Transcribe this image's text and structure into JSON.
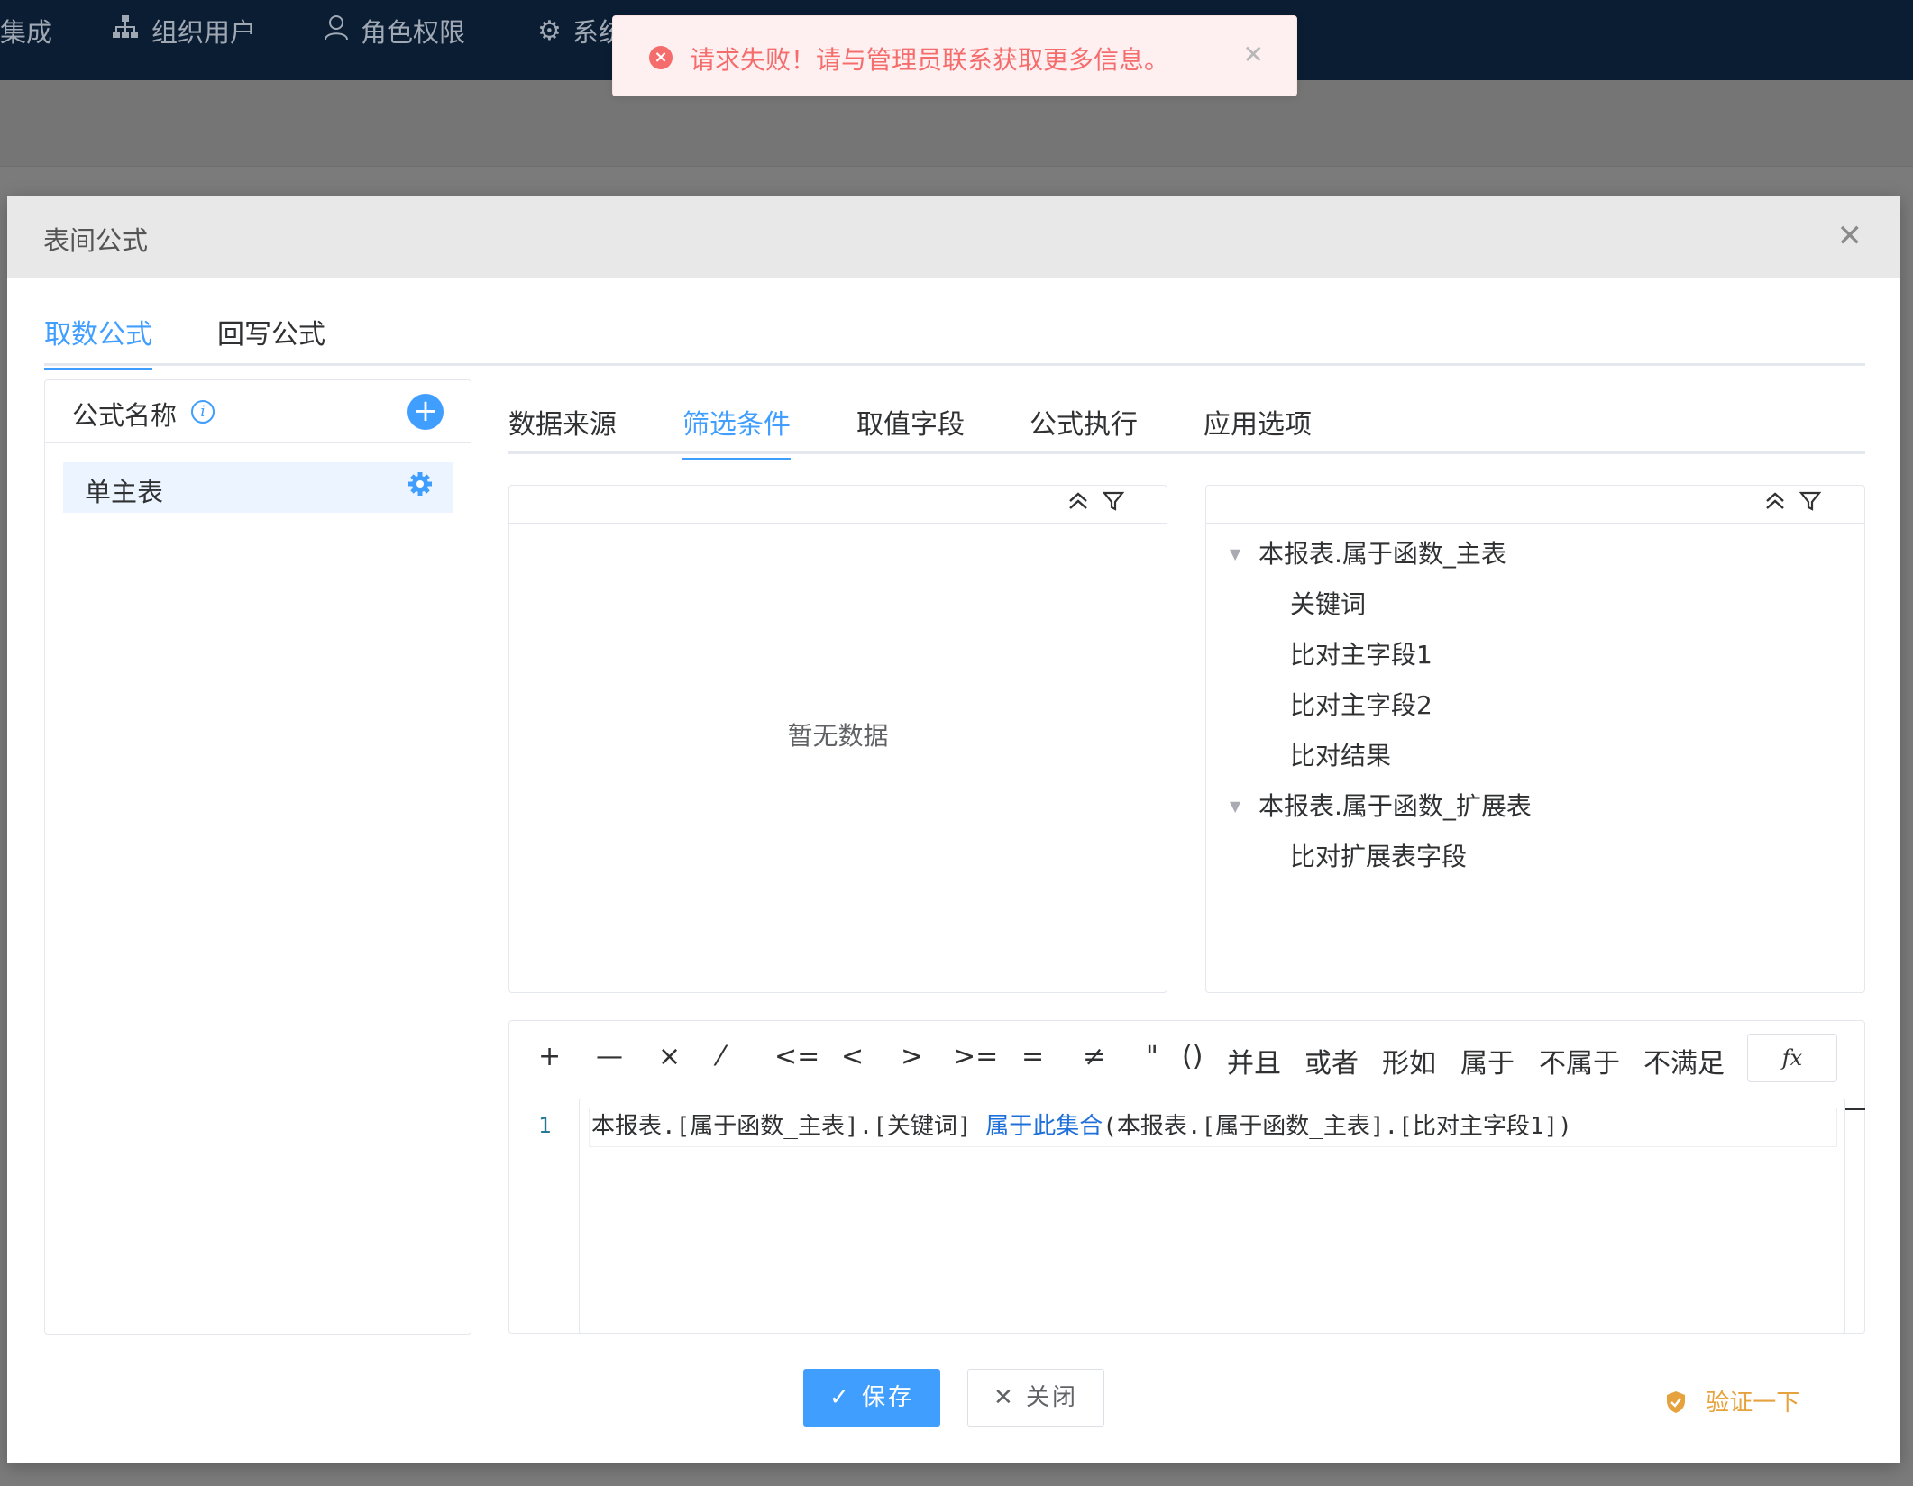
{
  "topnav": {
    "items": [
      {
        "label": "集成",
        "icon": ""
      },
      {
        "label": "组织用户",
        "icon": "org-icon"
      },
      {
        "label": "角色权限",
        "icon": "user-icon"
      },
      {
        "label": "系统",
        "icon": "gear-icon"
      }
    ]
  },
  "dialog": {
    "title": "表间公式",
    "main_tabs": [
      {
        "label": "取数公式",
        "active": true
      },
      {
        "label": "回写公式",
        "active": false
      }
    ],
    "formula_list": {
      "header": "公式名称",
      "items": [
        {
          "label": "单主表"
        }
      ]
    },
    "sub_tabs": [
      {
        "label": "数据来源",
        "active": false
      },
      {
        "label": "筛选条件",
        "active": true
      },
      {
        "label": "取值字段",
        "active": false
      },
      {
        "label": "公式执行",
        "active": false
      },
      {
        "label": "应用选项",
        "active": false
      }
    ],
    "left_tree": {
      "empty_text": "暂无数据"
    },
    "right_tree": {
      "nodes": [
        {
          "label": "本报表.属于函数_主表",
          "children": [
            "关键词",
            "比对主字段1",
            "比对主字段2",
            "比对结果"
          ]
        },
        {
          "label": "本报表.属于函数_扩展表",
          "children": [
            "比对扩展表字段"
          ]
        }
      ]
    },
    "operators": [
      "+",
      "—",
      "×",
      "⁄",
      "<=",
      "<",
      ">",
      ">=",
      "=",
      "≠",
      "\"",
      "()",
      "并且",
      "或者",
      "形如",
      "属于",
      "不属于",
      "不满足"
    ],
    "fx_label": "fx",
    "editor": {
      "line_number": "1",
      "code_part1": "本报表.[属于函数_主表].[关键词] ",
      "code_keyword": "属于此集合",
      "code_part2": "(本报表.[属于函数_主表].[比对主字段1])"
    },
    "footer": {
      "save_label": "保存",
      "close_label": "关闭",
      "verify_label": "验证一下"
    }
  },
  "toast": {
    "message": "请求失败！请与管理员联系获取更多信息。"
  },
  "colors": {
    "primary": "#409eff",
    "error": "#f56c6c",
    "warning": "#e6a23c",
    "topbar": "#0b1d33"
  }
}
